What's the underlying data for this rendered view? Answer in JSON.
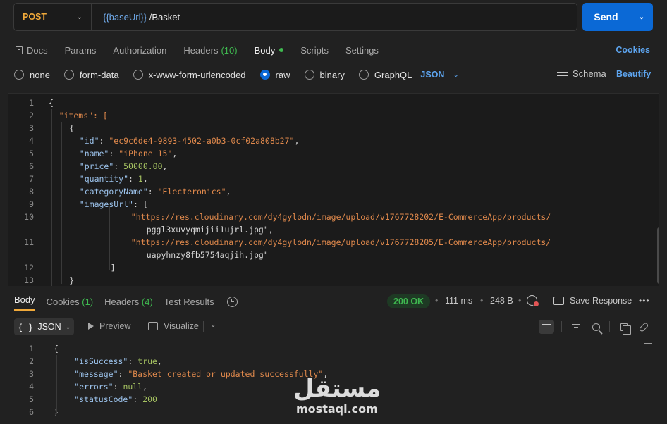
{
  "request": {
    "method": "POST",
    "url_variable": "{{baseUrl}}",
    "url_path": " /Basket",
    "send_label": "Send"
  },
  "request_tabs": [
    {
      "label": "Docs"
    },
    {
      "label": "Params"
    },
    {
      "label": "Authorization"
    },
    {
      "label": "Headers",
      "count": "(10)"
    },
    {
      "label": "Body",
      "active": true
    },
    {
      "label": "Scripts"
    },
    {
      "label": "Settings"
    }
  ],
  "cookies_label": "Cookies",
  "body_types": [
    "none",
    "form-data",
    "x-www-form-urlencoded",
    "raw",
    "binary",
    "GraphQL"
  ],
  "body_type_selected": "raw",
  "body_format": "JSON",
  "schema_label": "Schema",
  "beautify_label": "Beautify",
  "request_body_lines": [
    {
      "n": "1",
      "text": "{"
    },
    {
      "n": "2",
      "text": "\"items\": ["
    },
    {
      "n": "3",
      "text": "{"
    },
    {
      "n": "4",
      "key": "\"id\"",
      "val": "\"ec9c6de4-9893-4502-a0b3-0cf02a808b27\"",
      "tail": ","
    },
    {
      "n": "5",
      "key": "\"name\"",
      "val": "\"iPhone 15\"",
      "tail": ","
    },
    {
      "n": "6",
      "key": "\"price\"",
      "val": "50000.00",
      "tail": ","
    },
    {
      "n": "7",
      "key": "\"quantity\"",
      "val": "1",
      "tail": ","
    },
    {
      "n": "8",
      "key": "\"categoryName\"",
      "val": "\"Electeronics\"",
      "tail": ","
    },
    {
      "n": "9",
      "key": "\"imagesUrl\"",
      "val": "[",
      "tail": ""
    },
    {
      "n": "10",
      "text": "\"https://res.cloudinary.com/dy4gylodn/image/upload/v1767728202/E-CommerceApp/products/"
    },
    {
      "n": "",
      "text": "pggl3xuvyqmijii1ujrl.jpg\","
    },
    {
      "n": "11",
      "text": "\"https://res.cloudinary.com/dy4gylodn/image/upload/v1767728205/E-CommerceApp/products/"
    },
    {
      "n": "",
      "text": "uapyhnzy8fb5754aqjih.jpg\""
    },
    {
      "n": "12",
      "text": "]"
    },
    {
      "n": "13",
      "text": "}"
    }
  ],
  "response_tabs": [
    {
      "label": "Body",
      "active": true
    },
    {
      "label": "Cookies",
      "count": "(1)"
    },
    {
      "label": "Headers",
      "count": "(4)"
    },
    {
      "label": "Test Results"
    }
  ],
  "response_meta": {
    "status": "200 OK",
    "time": "111 ms",
    "size": "248 B",
    "save_label": "Save Response"
  },
  "response_toolbar": {
    "format": "JSON",
    "preview": "Preview",
    "visualize": "Visualize"
  },
  "response_body_lines": [
    {
      "n": "1",
      "text": "{"
    },
    {
      "n": "2",
      "key": "\"isSuccess\"",
      "val": "true",
      "tail": ","
    },
    {
      "n": "3",
      "key": "\"message\"",
      "val": "\"Basket created or updated successfully\"",
      "tail": ","
    },
    {
      "n": "4",
      "key": "\"errors\"",
      "val": "null",
      "tail": ","
    },
    {
      "n": "5",
      "key": "\"statusCode\"",
      "val": "200",
      "tail": ""
    },
    {
      "n": "6",
      "text": "}"
    }
  ],
  "watermark": {
    "arabic": "مستقل",
    "latin": "mostaql.com"
  },
  "colors": {
    "accent": "#0b69d6",
    "method": "#f0a93a",
    "success": "#3fb950",
    "link": "#5da4ee"
  }
}
